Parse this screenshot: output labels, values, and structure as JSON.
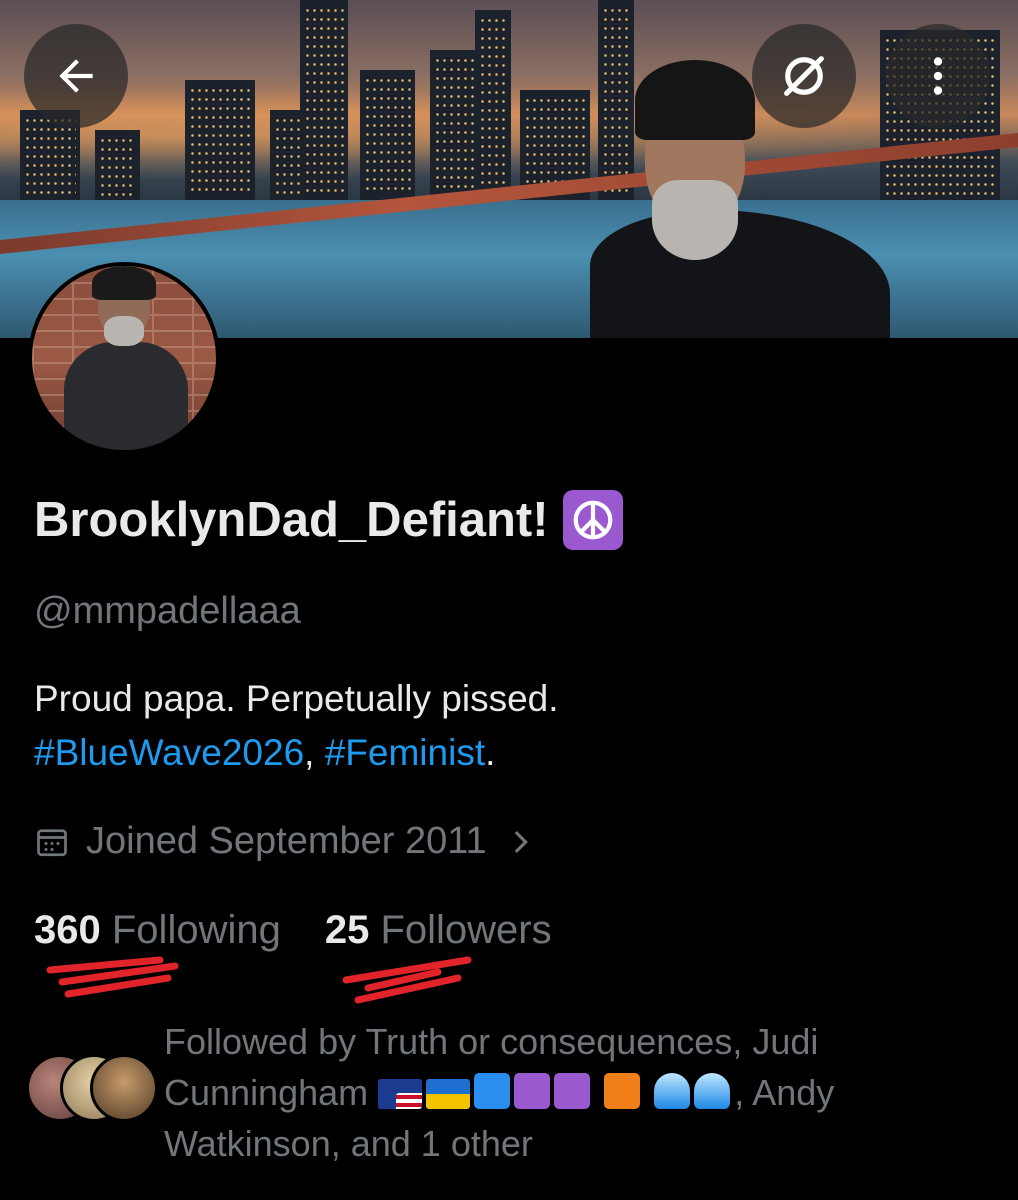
{
  "nav": {
    "back_icon": "arrow-left-icon",
    "grok_icon": "slashed-circle-icon",
    "more_icon": "vertical-dots-icon"
  },
  "profile": {
    "display_name": "BrooklynDad_Defiant!",
    "name_emoji": "peace-symbol",
    "handle": "@mmpadellaaa",
    "bio_text": "Proud papa. Perpetually pissed.",
    "bio_hashtag_1": "#BlueWave2026",
    "bio_separator": ", ",
    "bio_hashtag_2": "#Feminist",
    "bio_end": ".",
    "joined": "Joined September 2011",
    "following_count": "360",
    "following_label": "Following",
    "followers_count": "25",
    "followers_label": "Followers",
    "followed_by_prefix": "Followed by Truth or consequences, Judi Cunningham",
    "followed_by_suffix": ", Andy Watkinson, and 1 other"
  },
  "colors": {
    "background": "#000000",
    "text_primary": "#e7e9ea",
    "text_secondary": "#71767b",
    "link": "#1d9bf0",
    "scribble": "#e0242a"
  }
}
